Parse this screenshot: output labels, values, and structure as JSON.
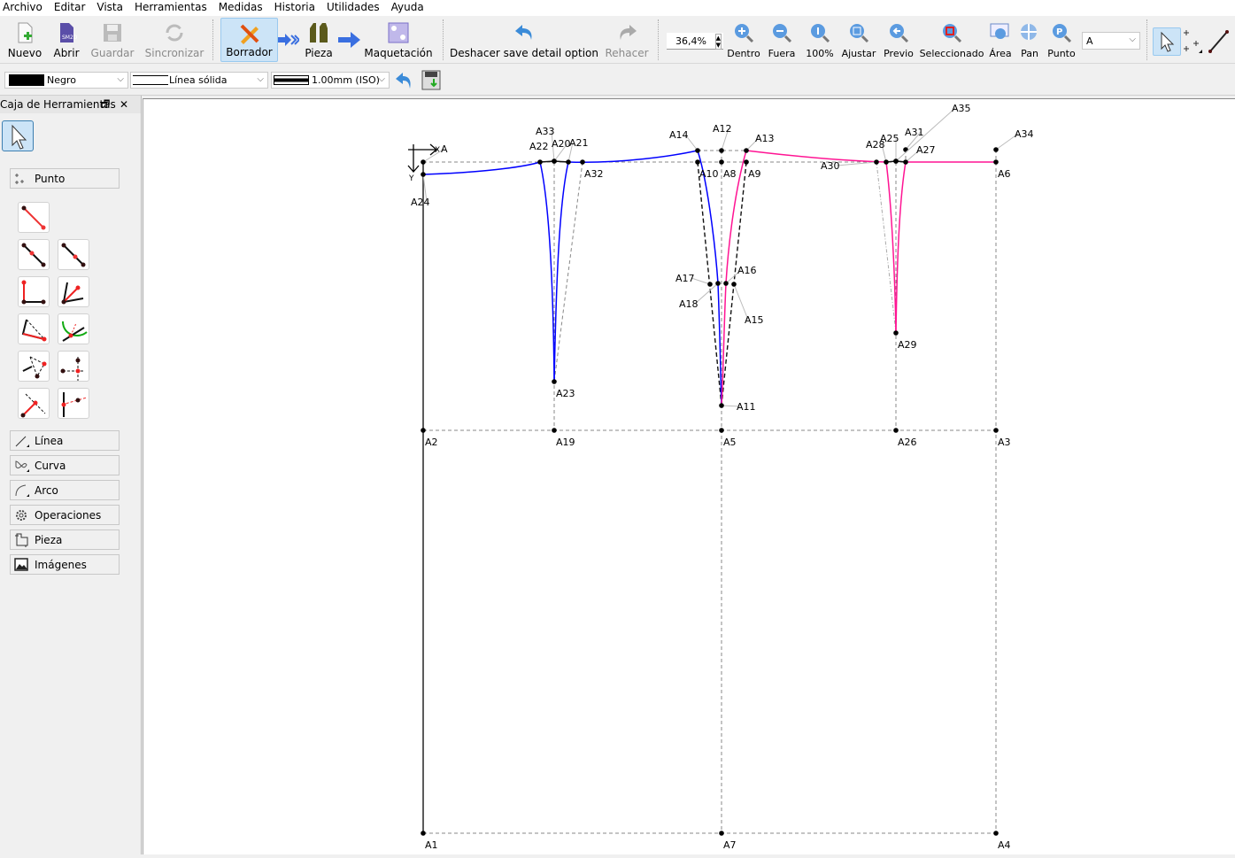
{
  "menu": [
    "Archivo",
    "Editar",
    "Vista",
    "Herramientas",
    "Medidas",
    "Historia",
    "Utilidades",
    "Ayuda"
  ],
  "toolbar": {
    "nuevo": "Nuevo",
    "abrir": "Abrir",
    "guardar": "Guardar",
    "sincronizar": "Sincronizar",
    "borrador": "Borrador",
    "pieza": "Pieza",
    "maquetacion": "Maquetación",
    "deshacer": "Deshacer save detail option",
    "rehacer": "Rehacer",
    "zoom_value": "36,4%",
    "dentro": "Dentro",
    "fuera": "Fuera",
    "cien": "100%",
    "ajustar": "Ajustar",
    "previo": "Previo",
    "seleccionado": "Seleccionado",
    "area": "Área",
    "pan": "Pan",
    "punto": "Punto",
    "pattern_block": "A"
  },
  "props": {
    "color": "Negro",
    "line_type": "Línea sólida",
    "line_weight": "1.00mm (ISO)"
  },
  "dock": {
    "title": "Caja de Herramientas",
    "groups": [
      "Punto",
      "Línea",
      "Curva",
      "Arco",
      "Operaciones",
      "Pieza",
      "Imágenes"
    ]
  },
  "canvas": {
    "axis_x": "X",
    "axis_y": "Y",
    "labels": [
      "A",
      "A24",
      "A2",
      "A1",
      "A22",
      "A33",
      "A20",
      "A21",
      "A32",
      "A23",
      "A19",
      "A14",
      "A12",
      "A13",
      "A10",
      "A8",
      "A9",
      "A17",
      "A18",
      "A16",
      "A15",
      "A11",
      "A5",
      "A7",
      "A30",
      "A28",
      "A25",
      "A31",
      "A27",
      "A35",
      "A29",
      "A26",
      "A6",
      "A34",
      "A3",
      "A4"
    ],
    "colors": {
      "blue": "#0000ff",
      "pink": "#ff1493",
      "dash": "#888888"
    }
  }
}
